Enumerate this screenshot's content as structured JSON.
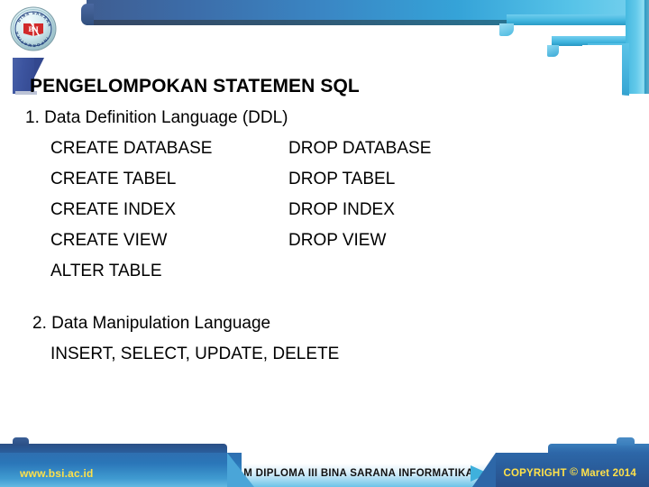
{
  "slide": {
    "title": "PENGELOMPOKAN STATEMEN SQL",
    "sections": [
      {
        "number": "1.",
        "heading": "Data Definition Language (DDL)",
        "rows": [
          {
            "left": "CREATE  DATABASE",
            "right": "DROP  DATABASE"
          },
          {
            "left": "CREATE  TABEL",
            "right": "DROP TABEL"
          },
          {
            "left": "CREATE   INDEX",
            "right": "DROP INDEX"
          },
          {
            "left": "CREATE   VIEW",
            "right": "DROP VIEW"
          },
          {
            "left": "ALTER TABLE",
            "right": ""
          }
        ]
      },
      {
        "number": "2.",
        "heading": "Data Manipulation Language",
        "rows": [
          {
            "left": "INSERT, SELECT, UPDATE, DELETE",
            "right": ""
          }
        ]
      }
    ]
  },
  "section1": {
    "num_heading": "1. Data Definition Language (DDL)",
    "r0a": "CREATE  DATABASE",
    "r0b": "DROP  DATABASE",
    "r1a": "CREATE  TABEL",
    "r1b": "DROP TABEL",
    "r2a": "CREATE   INDEX",
    "r2b": "DROP INDEX",
    "r3a": "CREATE   VIEW",
    "r3b": "DROP VIEW",
    "r4a": "ALTER TABLE"
  },
  "section2": {
    "num_heading": "2. Data Manipulation Language",
    "r0a": "INSERT, SELECT, UPDATE, DELETE"
  },
  "logo": {
    "name": "bsi-seal-logo",
    "mark": "BSI",
    "ring_top": "BINA SARANA",
    "ring_bottom": "INFORMATIKA"
  },
  "footer": {
    "url": "www.bsi.ac.id",
    "program": "PROGRAM DIPLOMA III BINA SARANA INFORMATIKA",
    "copyright_label": "COPYRIGHT",
    "copyright_symbol": "©",
    "copyright_date": "Maret 2014"
  },
  "colors": {
    "header_blue_dark": "#3f5d91",
    "header_blue_light": "#7ad2ee",
    "cyan": "#45b9e0",
    "tab_blue": "#33488f",
    "footer_blue": "#2a5f9e",
    "footer_yellow": "#ffe14a",
    "logo_red": "#d12b2b",
    "text_black": "#000000"
  }
}
